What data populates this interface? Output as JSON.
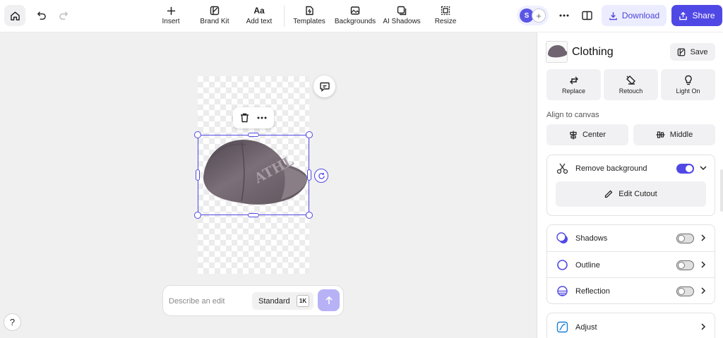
{
  "toolbar": {
    "tools": [
      {
        "label": "Insert",
        "icon": "plus-icon"
      },
      {
        "label": "Brand Kit",
        "icon": "brand-kit-icon"
      },
      {
        "label": "Add text",
        "icon": "text-icon",
        "glyph": "Aa"
      },
      {
        "label": "Templates",
        "icon": "templates-icon"
      },
      {
        "label": "Backgrounds",
        "icon": "backgrounds-icon"
      },
      {
        "label": "AI Shadows",
        "icon": "ai-shadows-icon"
      },
      {
        "label": "Resize",
        "icon": "resize-icon"
      }
    ],
    "avatar_initial": "S",
    "download_label": "Download",
    "share_label": "Share"
  },
  "canvas": {
    "edit_prompt_placeholder": "Describe an edit",
    "quality_label": "Standard",
    "resolution_badge": "1K",
    "help_label": "?"
  },
  "panel": {
    "title": "Clothing",
    "save_label": "Save",
    "tiles": [
      {
        "label": "Replace",
        "icon": "replace-icon"
      },
      {
        "label": "Retouch",
        "icon": "retouch-icon"
      },
      {
        "label": "Light On",
        "icon": "light-bulb-icon"
      }
    ],
    "align_label": "Align to canvas",
    "align_center": "Center",
    "align_middle": "Middle",
    "remove_background": {
      "label": "Remove background",
      "enabled": true
    },
    "edit_cutout_label": "Edit Cutout",
    "effects": [
      {
        "label": "Shadows",
        "enabled": false,
        "icon": "shadows-icon"
      },
      {
        "label": "Outline",
        "enabled": false,
        "icon": "outline-icon"
      },
      {
        "label": "Reflection",
        "enabled": false,
        "icon": "reflection-icon"
      }
    ],
    "adjust_label": "Adjust"
  },
  "colors": {
    "accent": "#5048e5",
    "accent_light": "#ececff",
    "canvas_bg": "#f0f0f0",
    "panel_tile": "#f1f1f3"
  }
}
